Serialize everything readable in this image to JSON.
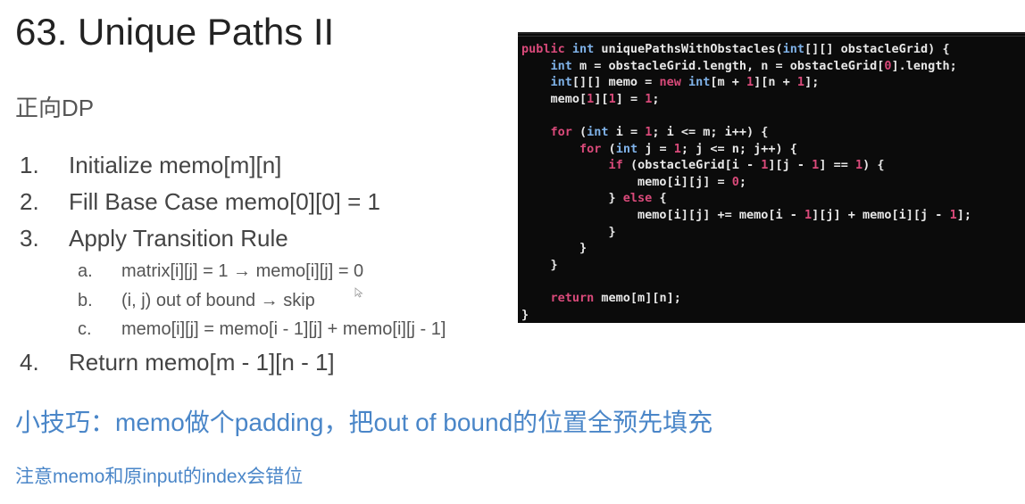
{
  "title": "63. Unique Paths II",
  "subtitle": "正向DP",
  "steps": [
    {
      "num": "1.",
      "text": "Initialize memo[m][n]"
    },
    {
      "num": "2.",
      "text": "Fill Base Case memo[0][0] = 1"
    },
    {
      "num": "3.",
      "text": "Apply Transition Rule"
    },
    {
      "num": "4.",
      "text": "Return memo[m - 1][n - 1]"
    }
  ],
  "substeps": [
    {
      "label": "a.",
      "text": "matrix[i][j] = 1 → memo[i][j] = 0"
    },
    {
      "label": "b.",
      "text": "(i, j) out of bound → skip"
    },
    {
      "label": "c.",
      "text": "memo[i][j] = memo[i - 1][j] + memo[i][j - 1]"
    }
  ],
  "tip": "小技巧：memo做个padding，把out of bound的位置全预先填充",
  "note": "注意memo和原input的index会错位",
  "code": {
    "lines": [
      [
        [
          "kw",
          "public "
        ],
        [
          "ty",
          "int "
        ],
        [
          "tx",
          "uniquePathsWithObstacles("
        ],
        [
          "ty",
          "int"
        ],
        [
          "tx",
          "[][] obstacleGrid) {"
        ]
      ],
      [
        [
          "tx",
          "    "
        ],
        [
          "ty",
          "int "
        ],
        [
          "tx",
          "m = obstacleGrid.length, n = obstacleGrid["
        ],
        [
          "nm",
          "0"
        ],
        [
          "tx",
          "].length;"
        ]
      ],
      [
        [
          "tx",
          "    "
        ],
        [
          "ty",
          "int"
        ],
        [
          "tx",
          "[][] memo = "
        ],
        [
          "kw",
          "new "
        ],
        [
          "ty",
          "int"
        ],
        [
          "tx",
          "[m + "
        ],
        [
          "nm",
          "1"
        ],
        [
          "tx",
          "][n + "
        ],
        [
          "nm",
          "1"
        ],
        [
          "tx",
          "];"
        ]
      ],
      [
        [
          "tx",
          "    memo["
        ],
        [
          "nm",
          "1"
        ],
        [
          "tx",
          "]["
        ],
        [
          "nm",
          "1"
        ],
        [
          "tx",
          "] = "
        ],
        [
          "nm",
          "1"
        ],
        [
          "tx",
          ";"
        ]
      ],
      [
        [
          "tx",
          ""
        ]
      ],
      [
        [
          "tx",
          "    "
        ],
        [
          "kw",
          "for "
        ],
        [
          "tx",
          "("
        ],
        [
          "ty",
          "int "
        ],
        [
          "tx",
          "i = "
        ],
        [
          "nm",
          "1"
        ],
        [
          "tx",
          "; i <= m; i++) {"
        ]
      ],
      [
        [
          "tx",
          "        "
        ],
        [
          "kw",
          "for "
        ],
        [
          "tx",
          "("
        ],
        [
          "ty",
          "int "
        ],
        [
          "tx",
          "j = "
        ],
        [
          "nm",
          "1"
        ],
        [
          "tx",
          "; j <= n; j++) {"
        ]
      ],
      [
        [
          "tx",
          "            "
        ],
        [
          "kw",
          "if "
        ],
        [
          "tx",
          "(obstacleGrid[i - "
        ],
        [
          "nm",
          "1"
        ],
        [
          "tx",
          "][j - "
        ],
        [
          "nm",
          "1"
        ],
        [
          "tx",
          "] == "
        ],
        [
          "nm",
          "1"
        ],
        [
          "tx",
          ") {"
        ]
      ],
      [
        [
          "tx",
          "                memo[i][j] = "
        ],
        [
          "nm",
          "0"
        ],
        [
          "tx",
          ";"
        ]
      ],
      [
        [
          "tx",
          "            } "
        ],
        [
          "kw",
          "else "
        ],
        [
          "tx",
          "{"
        ]
      ],
      [
        [
          "tx",
          "                memo[i][j] += memo[i - "
        ],
        [
          "nm",
          "1"
        ],
        [
          "tx",
          "][j] + memo[i][j - "
        ],
        [
          "nm",
          "1"
        ],
        [
          "tx",
          "];"
        ]
      ],
      [
        [
          "tx",
          "            }"
        ]
      ],
      [
        [
          "tx",
          "        }"
        ]
      ],
      [
        [
          "tx",
          "    }"
        ]
      ],
      [
        [
          "tx",
          ""
        ]
      ],
      [
        [
          "tx",
          "    "
        ],
        [
          "kw",
          "return "
        ],
        [
          "tx",
          "memo[m][n];"
        ]
      ],
      [
        [
          "tx",
          "}"
        ]
      ]
    ]
  }
}
